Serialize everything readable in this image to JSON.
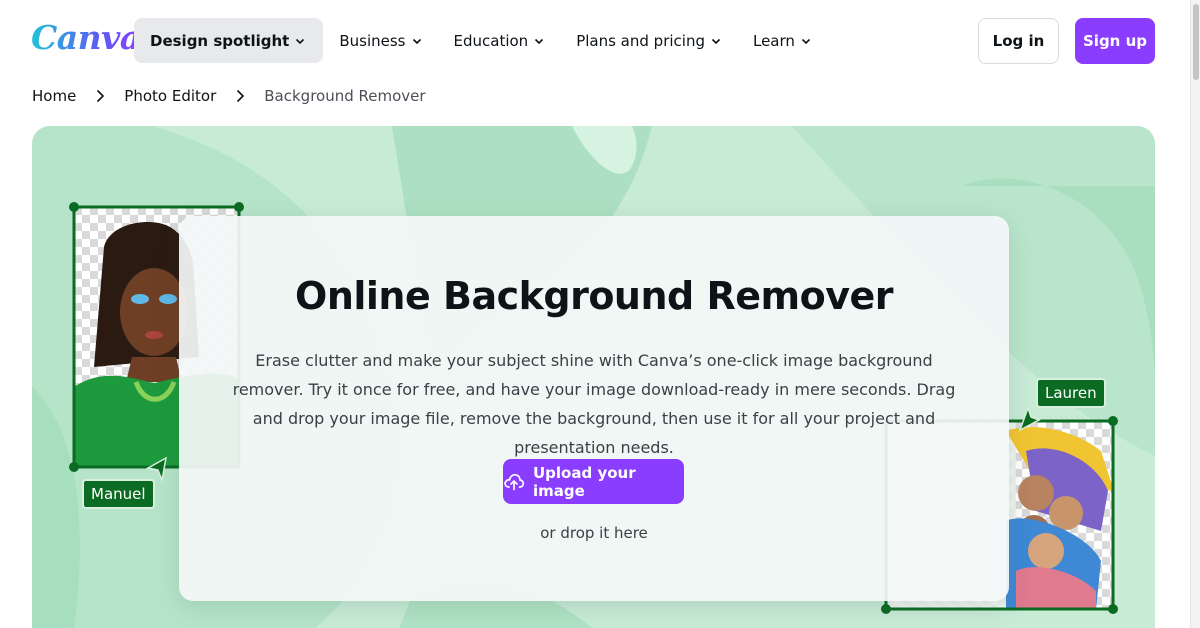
{
  "header": {
    "logo": "Canva",
    "nav": [
      {
        "label": "Design spotlight",
        "active": true
      },
      {
        "label": "Business"
      },
      {
        "label": "Education"
      },
      {
        "label": "Plans and pricing"
      },
      {
        "label": "Learn"
      }
    ],
    "login_label": "Log in",
    "signup_label": "Sign up"
  },
  "breadcrumb": [
    "Home",
    "Photo Editor",
    "Background Remover"
  ],
  "hero": {
    "title": "Online Background Remover",
    "description": "Erase clutter and make your subject shine with Canva’s one-click image background remover. Try it once for free, and have your image download-ready in mere seconds. Drag and drop your image file, remove the background, then use it for all your project and presentation needs.",
    "upload_label": "Upload your image",
    "drop_text": "or drop it here",
    "labels": {
      "left": "Manuel",
      "right": "Lauren"
    }
  },
  "colors": {
    "brand_purple": "#8b3dff",
    "hero_bg": "#c9ecd8",
    "frame_green": "#0b6b22"
  },
  "icons": [
    "chevron-down-icon",
    "chevron-right-icon",
    "cloud-upload-icon",
    "cursor-arrow-icon"
  ]
}
